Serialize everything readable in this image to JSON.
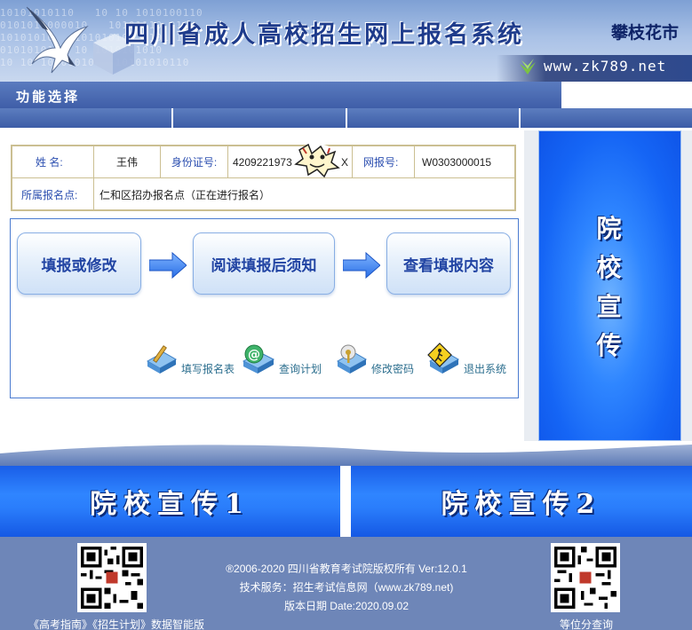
{
  "header": {
    "title": "四川省成人高校招生网上报名系统",
    "city": "攀枝花市",
    "url": "www.zk789.net",
    "binary_pattern": "10101010110   10 10 1010100110\n0101011000010   10101110 010\n10101010   10101010   1010101\n0101010110 10 1010101010\n10 10 10101010   10101010110"
  },
  "func_bar": {
    "title": "功能选择",
    "tabs": [
      "",
      "",
      "",
      ""
    ]
  },
  "info": {
    "name_label": "姓  名:",
    "name_value": "王伟",
    "id_label": "身份证号:",
    "id_value": "4209221973",
    "id_suffix": "X",
    "reg_label": "网报号:",
    "reg_value": "W0303000015",
    "site_label": "所属报名点:",
    "site_value": "仁和区招办报名点（正在进行报名）"
  },
  "actions": {
    "fill_label": "填报或修改",
    "read_label": "阅读填报后须知",
    "view_label": "查看填报内容"
  },
  "tools": [
    {
      "label": "填写报名表",
      "icon": "form-edit-icon"
    },
    {
      "label": "查询计划",
      "icon": "email-query-icon"
    },
    {
      "label": "修改密码",
      "icon": "password-key-icon"
    },
    {
      "label": "退出系统",
      "icon": "exit-warning-icon"
    }
  ],
  "side_promo": {
    "text": "院\n校\n宣\n传"
  },
  "banners": {
    "left": "院校宣传1",
    "right": "院校宣传2"
  },
  "footer": {
    "copyright": "®2006-2020 四川省教育考试院版权所有 Ver:12.0.1",
    "service": "技术服务：招生考试信息网（www.zk789.net)",
    "version_date": "版本日期 Date:2020.09.02",
    "left_caption": "《高考指南》《招生计划》数据智能版",
    "right_caption": "等位分查询"
  },
  "colors": {
    "accent_blue": "#1565f5",
    "label_blue": "#2c4fb0",
    "table_border": "#cbbf92",
    "footer_bg": "#6e86b8"
  }
}
